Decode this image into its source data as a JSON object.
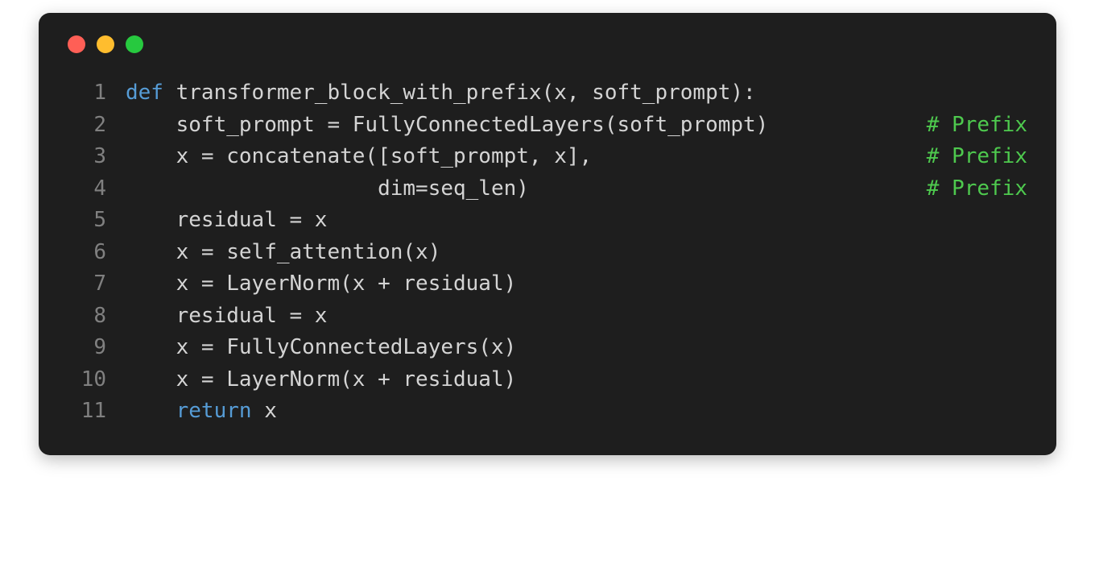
{
  "traffic_lights": [
    "red",
    "yellow",
    "green"
  ],
  "code": {
    "lines": [
      {
        "n": "1",
        "indent": "",
        "segments": [
          {
            "t": "def ",
            "cls": "kw"
          },
          {
            "t": "transformer_block_with_prefix(x, soft_prompt):",
            "cls": ""
          }
        ],
        "comment": ""
      },
      {
        "n": "2",
        "indent": "    ",
        "segments": [
          {
            "t": "soft_prompt = FullyConnectedLayers(soft_prompt)",
            "cls": ""
          }
        ],
        "comment": "# Prefix"
      },
      {
        "n": "3",
        "indent": "    ",
        "segments": [
          {
            "t": "x = concatenate([soft_prompt, x],",
            "cls": ""
          }
        ],
        "comment": "# Prefix"
      },
      {
        "n": "4",
        "indent": "                    ",
        "segments": [
          {
            "t": "dim=seq_len)",
            "cls": ""
          }
        ],
        "comment": "# Prefix"
      },
      {
        "n": "5",
        "indent": "    ",
        "segments": [
          {
            "t": "residual = x",
            "cls": ""
          }
        ],
        "comment": ""
      },
      {
        "n": "6",
        "indent": "    ",
        "segments": [
          {
            "t": "x = self_attention(x)",
            "cls": ""
          }
        ],
        "comment": ""
      },
      {
        "n": "7",
        "indent": "    ",
        "segments": [
          {
            "t": "x = LayerNorm(x + residual)",
            "cls": ""
          }
        ],
        "comment": ""
      },
      {
        "n": "8",
        "indent": "    ",
        "segments": [
          {
            "t": "residual = x",
            "cls": ""
          }
        ],
        "comment": ""
      },
      {
        "n": "9",
        "indent": "    ",
        "segments": [
          {
            "t": "x = FullyConnectedLayers(x)",
            "cls": ""
          }
        ],
        "comment": ""
      },
      {
        "n": "10",
        "indent": "    ",
        "segments": [
          {
            "t": "x = LayerNorm(x + residual)",
            "cls": ""
          }
        ],
        "comment": ""
      },
      {
        "n": "11",
        "indent": "    ",
        "segments": [
          {
            "t": "return ",
            "cls": "kw"
          },
          {
            "t": "x",
            "cls": ""
          }
        ],
        "comment": ""
      }
    ]
  }
}
